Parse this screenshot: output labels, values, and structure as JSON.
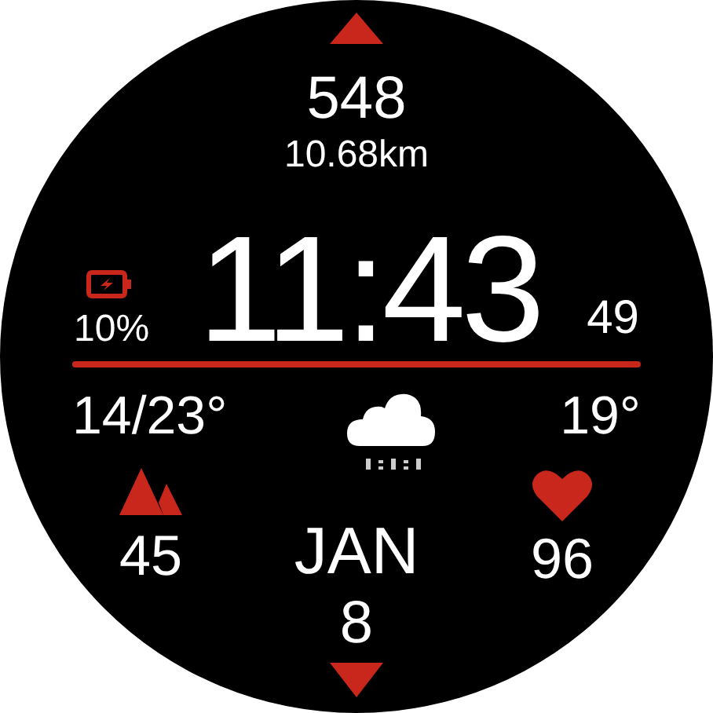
{
  "steps": "548",
  "distance": "10.68km",
  "battery": {
    "reading": "10%"
  },
  "time": {
    "clock": "11:43",
    "seconds": "49"
  },
  "weather": {
    "range": "14/23°",
    "current": "19°"
  },
  "elevation": "45",
  "heart_rate": "96",
  "date": {
    "month": "JAN",
    "day": "8"
  }
}
